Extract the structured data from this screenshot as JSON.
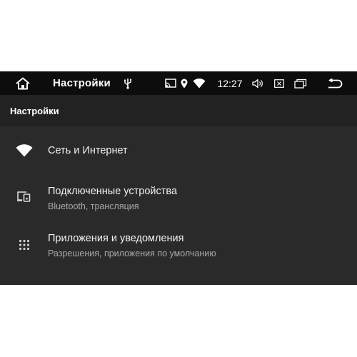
{
  "statusbar": {
    "title": "Настройки",
    "time": "12:27",
    "icons": [
      "home-icon",
      "usb-icon",
      "cast-icon",
      "location-icon",
      "wifi-icon",
      "volume-icon",
      "close-box-icon",
      "windows-icon",
      "back-icon"
    ]
  },
  "header": {
    "title": "Настройки"
  },
  "settings": {
    "items": [
      {
        "icon": "wifi-icon",
        "title": "Сеть и Интернет",
        "subtitle": ""
      },
      {
        "icon": "connected-devices-icon",
        "title": "Подключенные устройства",
        "subtitle": "Bluetooth, трансляция"
      },
      {
        "icon": "apps-grid-icon",
        "title": "Приложения и уведомления",
        "subtitle": "Разрешения, приложения по умолчанию"
      }
    ]
  },
  "colors": {
    "statusbar_bg": "#0d0d0d",
    "header_bg": "#222222",
    "content_bg": "#2a2a2a",
    "text_primary": "#f2f2f2",
    "text_secondary": "#a8a8a8"
  }
}
